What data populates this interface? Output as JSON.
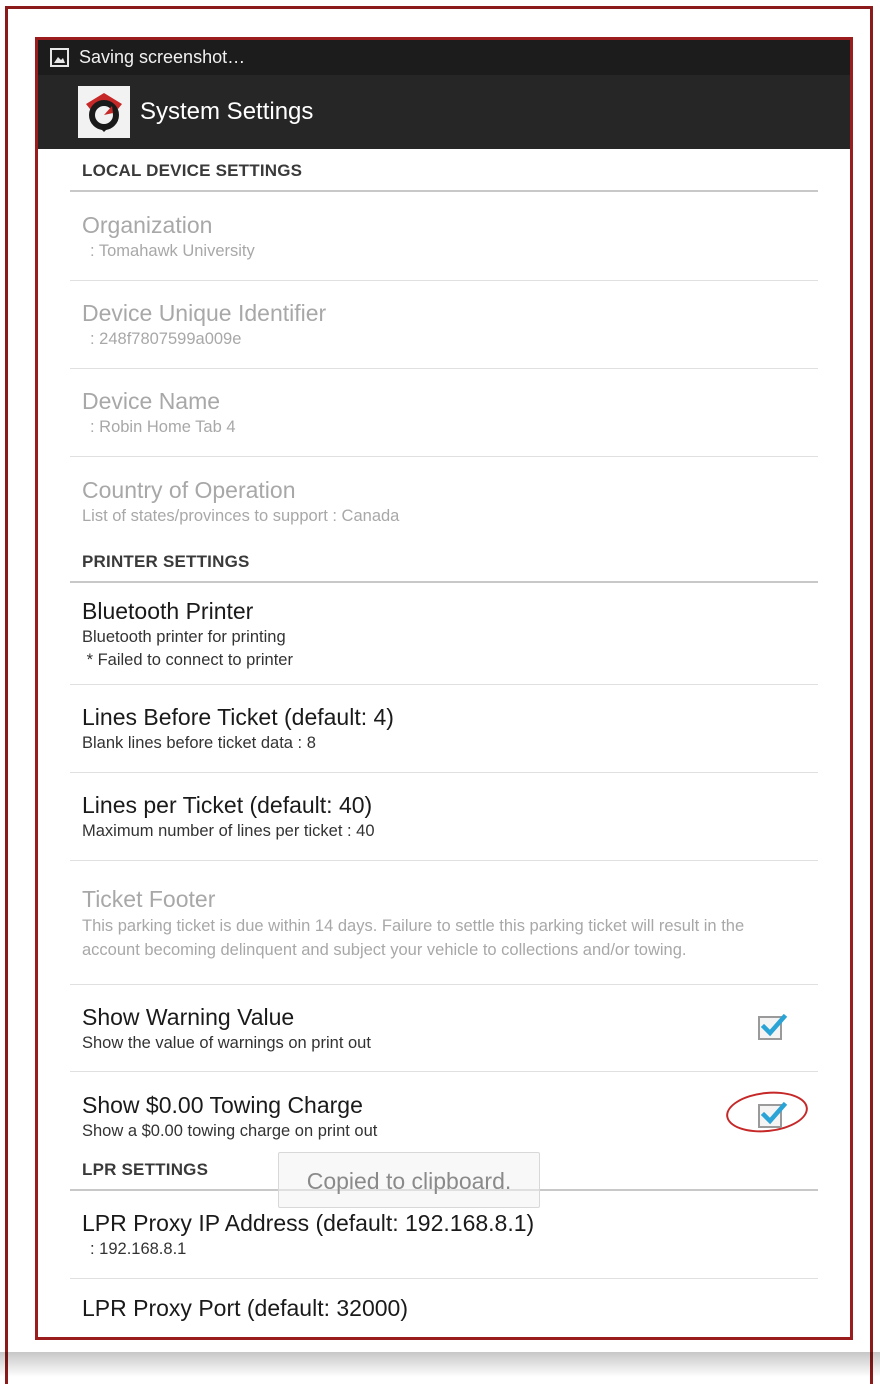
{
  "status_bar": {
    "text": "Saving screenshot…",
    "icon": "image-icon"
  },
  "action_bar": {
    "title": "System Settings",
    "logo": "app-logo-icon"
  },
  "sections": {
    "local": {
      "header": "LOCAL DEVICE SETTINGS",
      "organization": {
        "title": "Organization",
        "summary": ": Tomahawk University"
      },
      "device_id": {
        "title": "Device Unique Identifier",
        "summary": ": 248f7807599a009e"
      },
      "device_name": {
        "title": "Device Name",
        "summary": ": Robin Home Tab 4"
      },
      "country": {
        "title": "Country of Operation",
        "summary": "List of states/provinces to support : Canada"
      }
    },
    "printer": {
      "header": "PRINTER SETTINGS",
      "bluetooth": {
        "title": "Bluetooth Printer",
        "summary": "Bluetooth printer for printing",
        "summary2": " * Failed to connect to printer"
      },
      "lines_before": {
        "title": "Lines Before Ticket (default: 4)",
        "summary": "Blank lines before ticket data : 8"
      },
      "lines_per": {
        "title": "Lines per Ticket (default: 40)",
        "summary": "Maximum number of lines per ticket : 40"
      },
      "footer": {
        "title": "Ticket Footer",
        "summary": "This parking ticket is due within 14 days. Failure to settle this parking ticket will result in the account becoming delinquent and subject your vehicle to collections and/or towing."
      },
      "show_warning": {
        "title": "Show Warning Value",
        "summary": "Show the value of warnings on print out",
        "checked": true
      },
      "show_towing": {
        "title": "Show $0.00 Towing Charge",
        "summary": "Show a $0.00 towing charge on print out",
        "checked": true
      }
    },
    "lpr": {
      "header": "LPR SETTINGS",
      "proxy_ip": {
        "title": "LPR Proxy IP Address (default: 192.168.8.1)",
        "summary": ": 192.168.8.1"
      },
      "proxy_port": {
        "title": "LPR Proxy Port (default: 32000)"
      }
    }
  },
  "toast": {
    "text": "Copied to clipboard."
  },
  "colors": {
    "frame": "#9b1c1c",
    "check": "#33b5e5",
    "annotation": "#c62828"
  }
}
